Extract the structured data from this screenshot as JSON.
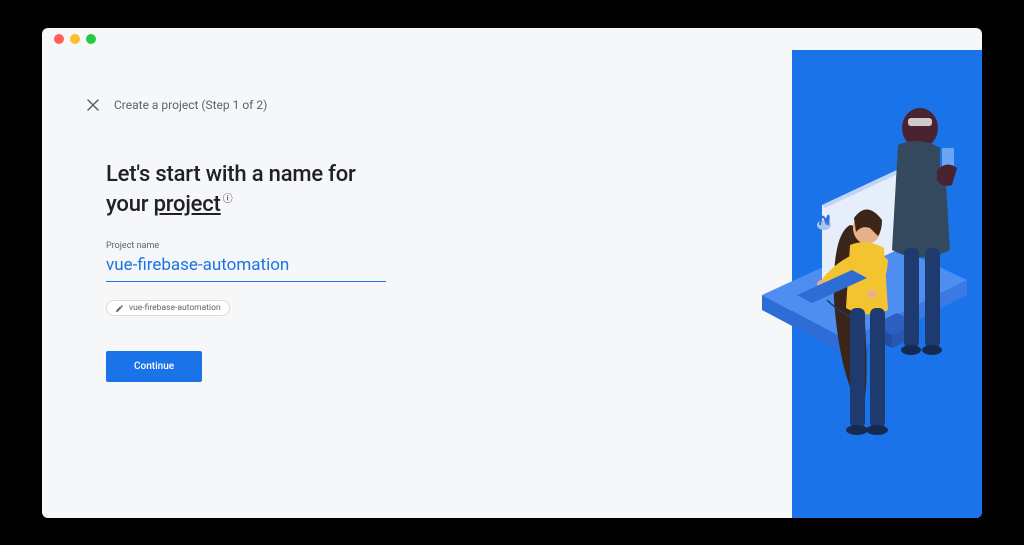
{
  "header": {
    "title": "Create a project (Step 1 of 2)"
  },
  "heading": {
    "line1": "Let's start with a name for",
    "line2_prefix": "your ",
    "line2_underlined": "project"
  },
  "field": {
    "label": "Project name",
    "value": "vue-firebase-automation"
  },
  "chip": {
    "project_id": "vue-firebase-automation"
  },
  "buttons": {
    "continue": "Continue"
  },
  "colors": {
    "primary": "#1a73e8",
    "text_primary": "#202124",
    "text_secondary": "#5f6368"
  }
}
